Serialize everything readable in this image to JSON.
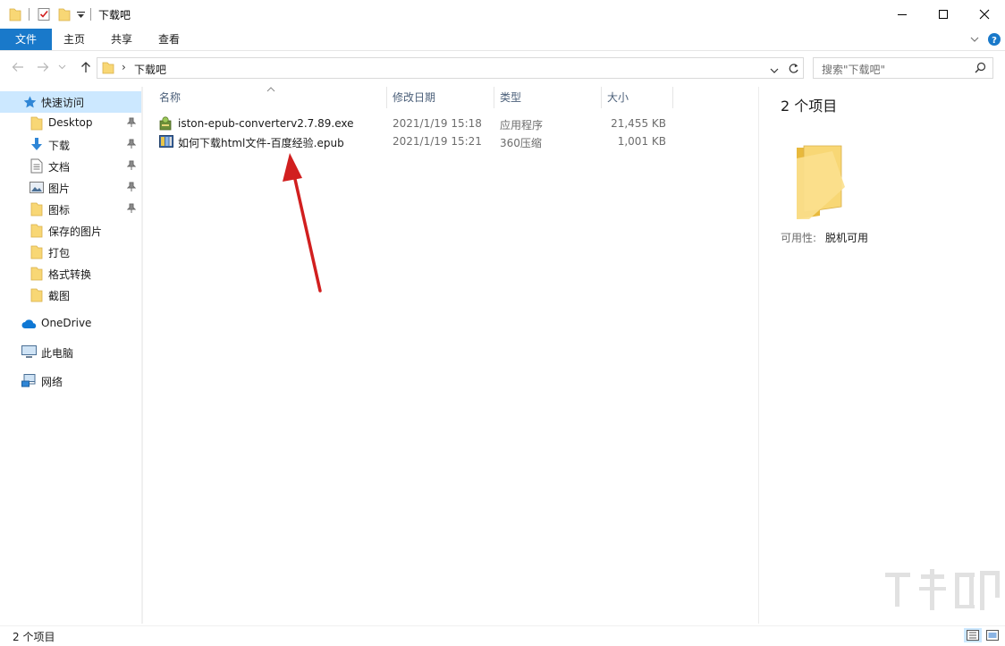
{
  "window": {
    "title": "下载吧"
  },
  "ribbon": {
    "tabs": [
      {
        "label": "文件"
      },
      {
        "label": "主页"
      },
      {
        "label": "共享"
      },
      {
        "label": "查看"
      }
    ]
  },
  "address": {
    "crumb": "下载吧",
    "separator": "›"
  },
  "search": {
    "placeholder": "搜索\"下载吧\""
  },
  "nav": {
    "quick_access": "快速访问",
    "items": [
      {
        "label": "Desktop",
        "icon": "folder-icon",
        "pinned": true
      },
      {
        "label": "下载",
        "icon": "download-icon",
        "pinned": true
      },
      {
        "label": "文档",
        "icon": "document-icon",
        "pinned": true
      },
      {
        "label": "图片",
        "icon": "pictures-icon",
        "pinned": true
      },
      {
        "label": "图标",
        "icon": "folder-icon",
        "pinned": true
      },
      {
        "label": "保存的图片",
        "icon": "folder-icon",
        "pinned": false
      },
      {
        "label": "打包",
        "icon": "folder-icon",
        "pinned": false
      },
      {
        "label": "格式转换",
        "icon": "folder-icon",
        "pinned": false
      },
      {
        "label": "截图",
        "icon": "folder-icon",
        "pinned": false
      }
    ],
    "onedrive": "OneDrive",
    "this_pc": "此电脑",
    "network": "网络"
  },
  "columns": {
    "name": "名称",
    "modified": "修改日期",
    "type": "类型",
    "size": "大小"
  },
  "files": [
    {
      "name": "iston-epub-converterv2.7.89.exe",
      "modified": "2021/1/19 15:18",
      "type": "应用程序",
      "size": "21,455 KB",
      "icon": "installer-icon"
    },
    {
      "name": "如何下载html文件-百度经验.epub",
      "modified": "2021/1/19 15:21",
      "type": "360压缩",
      "size": "1,001 KB",
      "icon": "archive-icon"
    }
  ],
  "details": {
    "count": "2 个项目",
    "availability_label": "可用性:",
    "availability_value": "脱机可用"
  },
  "status": {
    "text": "2 个项目"
  },
  "colors": {
    "accent": "#1979ca",
    "selected_bg": "#cce8ff",
    "folder": "#f8d775",
    "annotation_arrow": "#d11f1f"
  }
}
